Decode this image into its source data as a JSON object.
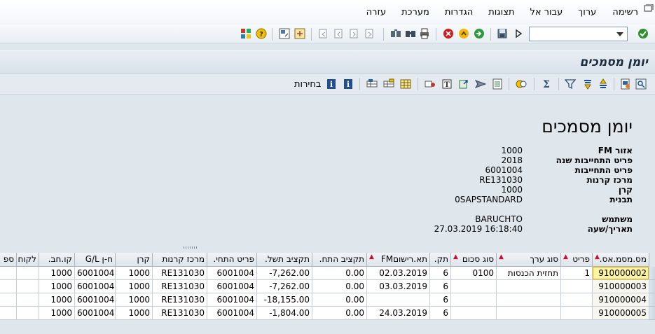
{
  "menu": {
    "items": [
      "רשימה",
      "ערוך",
      "עבור אל",
      "תצוגות",
      "הגדרות",
      "מערכת",
      "עזרה"
    ]
  },
  "command_field": {
    "value": ""
  },
  "title": "יומן מסמכים",
  "app_toolbar": {
    "choices_label": "בחירות"
  },
  "report": {
    "title": "יומן מסמכים",
    "fields": [
      {
        "label": "אזור FM",
        "value": "1000"
      },
      {
        "label": "פריט התחייבות שנה",
        "value": "2018"
      },
      {
        "label": "פריט התחייבות",
        "value": "6001004"
      },
      {
        "label": "מרכז קרנות",
        "value": "RE131030"
      },
      {
        "label": "קרן",
        "value": "1000"
      },
      {
        "label": "תבנית",
        "value": "0SAPSTANDARD"
      }
    ],
    "user_fields": [
      {
        "label": "משתמש",
        "value": "BARUCHTO"
      },
      {
        "label": "תאריך/שעה",
        "value": "27.03.2019 16:18:40"
      }
    ]
  },
  "table": {
    "columns": [
      {
        "key": "doc",
        "label": "מס.מסמ.אס.",
        "sorted": true
      },
      {
        "key": "item",
        "label": "פריט",
        "sorted": true
      },
      {
        "key": "valtype",
        "label": "סוג ערך",
        "sorted": true
      },
      {
        "key": "amttype",
        "label": "סוג סכום",
        "sorted": true
      },
      {
        "key": "per",
        "label": "תק."
      },
      {
        "key": "fmdate",
        "label": "תא.רישוםFM",
        "sorted": true
      },
      {
        "key": "budget",
        "label": "תקציב התח."
      },
      {
        "key": "paybudget",
        "label": "תקציב תשל."
      },
      {
        "key": "cmmt",
        "label": "פריט התחי."
      },
      {
        "key": "fc",
        "label": "מרכז קרנות"
      },
      {
        "key": "fund",
        "label": "קרן"
      },
      {
        "key": "gl",
        "label": "ח-ן G/L"
      },
      {
        "key": "cocode",
        "label": "קו.חב."
      },
      {
        "key": "cust",
        "label": "לקוח"
      },
      {
        "key": "vend",
        "label": "ספ"
      }
    ],
    "rows": [
      {
        "doc": "910000002",
        "item": "1",
        "valtype": "תחזית הכנסות",
        "amttype": "0100",
        "per": "6",
        "fmdate": "02.03.2019",
        "budget": "0.00",
        "paybudget": "-7,262.00",
        "cmmt": "6001004",
        "fc": "RE131030",
        "fund": "1000",
        "gl": "6001004",
        "cocode": "1000",
        "cust": "",
        "vend": ""
      },
      {
        "doc": "910000003",
        "item": "",
        "valtype": "",
        "amttype": "",
        "per": "6",
        "fmdate": "03.03.2019",
        "budget": "0.00",
        "paybudget": "-7,262.00",
        "cmmt": "6001004",
        "fc": "RE131030",
        "fund": "1000",
        "gl": "6001004",
        "cocode": "1000",
        "cust": "",
        "vend": ""
      },
      {
        "doc": "910000004",
        "item": "",
        "valtype": "",
        "amttype": "",
        "per": "6",
        "fmdate": "",
        "budget": "0.00",
        "paybudget": "-18,155.00",
        "cmmt": "6001004",
        "fc": "RE131030",
        "fund": "1000",
        "gl": "6001004",
        "cocode": "1000",
        "cust": "",
        "vend": ""
      },
      {
        "doc": "910000005",
        "item": "",
        "valtype": "",
        "amttype": "",
        "per": "6",
        "fmdate": "24.03.2019",
        "budget": "0.00",
        "paybudget": "-1,804.00",
        "cmmt": "6001004",
        "fc": "RE131030",
        "fund": "1000",
        "gl": "6001004",
        "cocode": "1000",
        "cust": "",
        "vend": ""
      }
    ]
  },
  "colors": {
    "accent_ok": "#2f8f2f",
    "error": "#d21b1b",
    "sort_marker": "#c8102e",
    "selected_cell": "#fff3a6"
  }
}
